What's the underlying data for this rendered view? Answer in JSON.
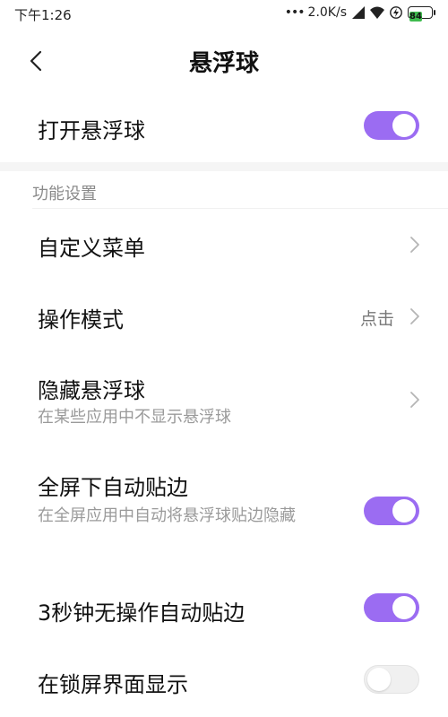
{
  "status_bar": {
    "time": "下午1:26",
    "dots": "•••",
    "network_speed": "2.0K/s",
    "battery_level": "84",
    "icons": [
      "signal-icon",
      "wifi-icon",
      "bolt-icon",
      "battery-icon"
    ],
    "battery_color": "#3fbb4e"
  },
  "header": {
    "title": "悬浮球",
    "back_icon": "chevron-left-icon"
  },
  "accent_color": "#9b6cf2",
  "main_toggle": {
    "label": "打开悬浮球",
    "on": true
  },
  "section": {
    "title": "功能设置"
  },
  "items": [
    {
      "title": "自定义菜单",
      "type": "link"
    },
    {
      "title": "操作模式",
      "value": "点击",
      "type": "link"
    },
    {
      "title": "隐藏悬浮球",
      "subtitle": "在某些应用中不显示悬浮球",
      "type": "link"
    },
    {
      "title": "全屏下自动贴边",
      "subtitle": "在全屏应用中自动将悬浮球贴边隐藏",
      "type": "toggle",
      "on": true
    },
    {
      "title": "3秒钟无操作自动贴边",
      "type": "toggle",
      "on": true
    },
    {
      "title": "在锁屏界面显示",
      "type": "toggle",
      "on": false
    }
  ]
}
